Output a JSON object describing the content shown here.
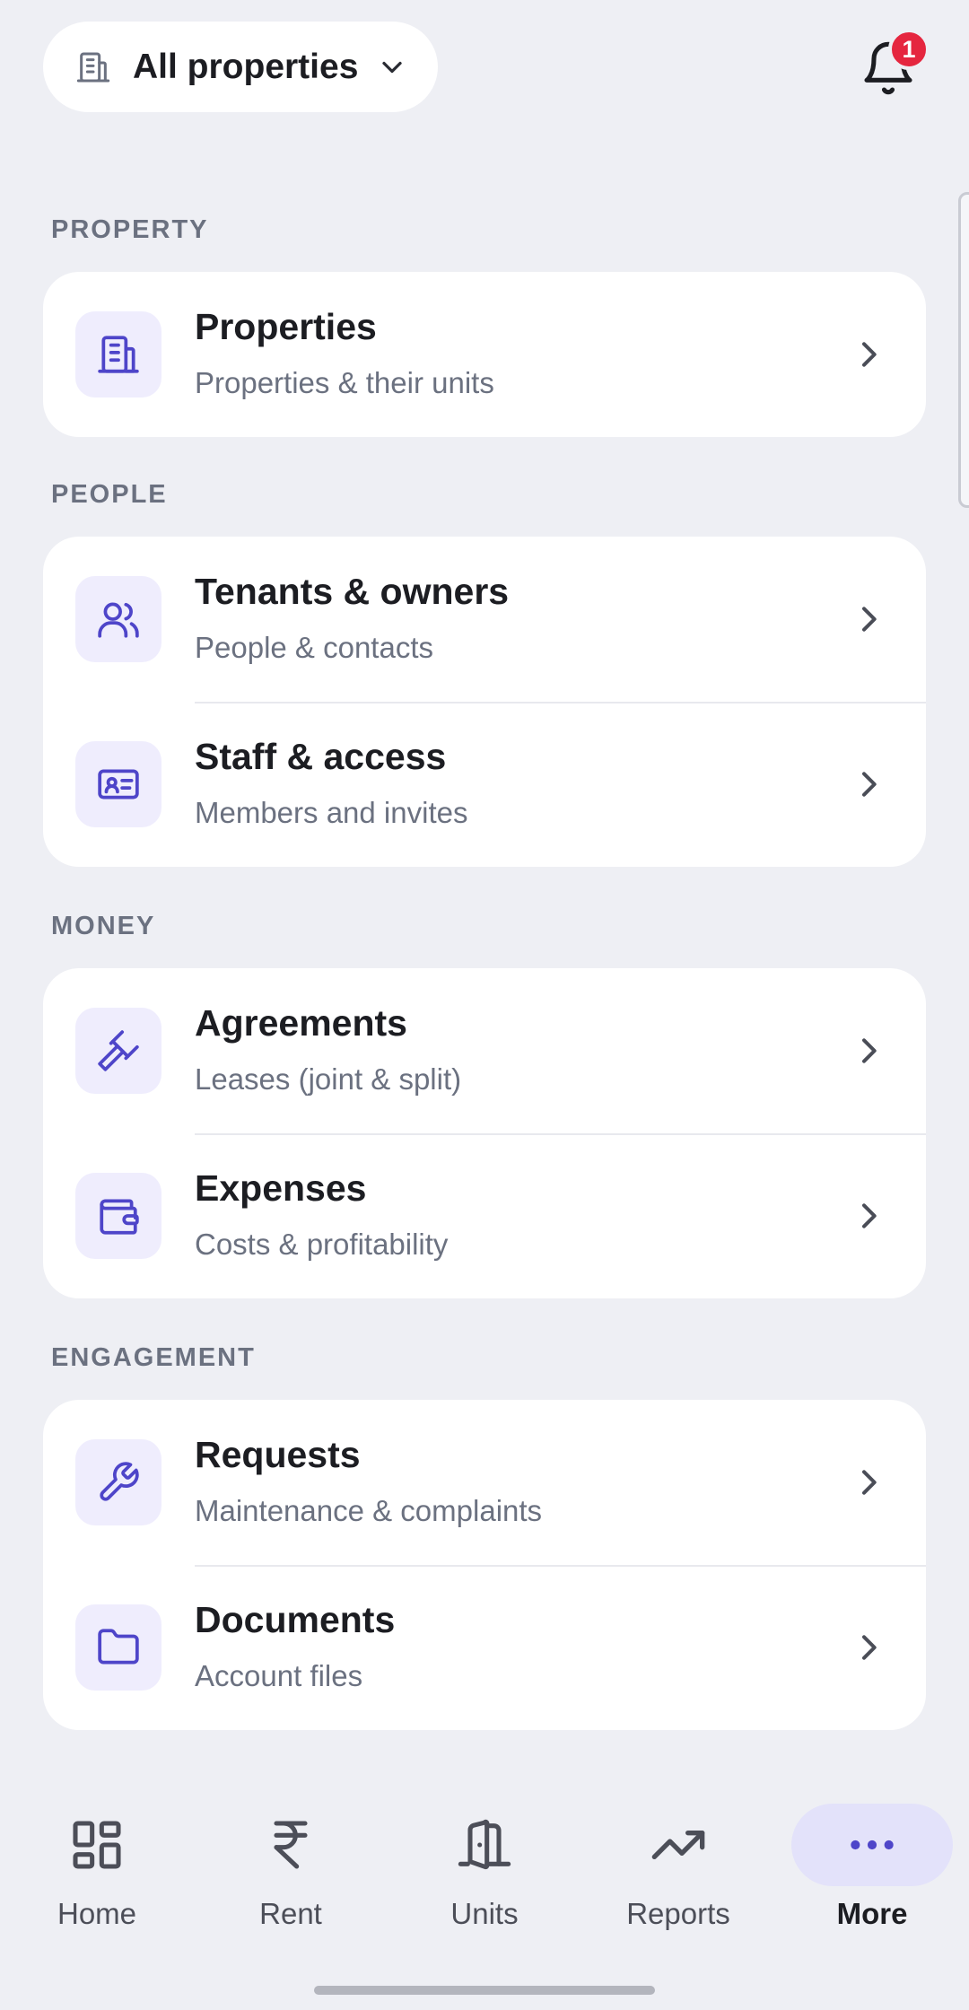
{
  "header": {
    "property_selector": {
      "label": "All properties",
      "icon": "building-icon",
      "chevron": "chevron-down-icon"
    },
    "notifications": {
      "icon": "bell-icon",
      "count": "1",
      "badge_color": "#e5263f"
    }
  },
  "sections": [
    {
      "heading": "PROPERTY",
      "items": [
        {
          "title": "Properties",
          "subtitle": "Properties & their units",
          "icon": "building-icon"
        }
      ]
    },
    {
      "heading": "PEOPLE",
      "items": [
        {
          "title": "Tenants & owners",
          "subtitle": "People & contacts",
          "icon": "users-icon"
        },
        {
          "title": "Staff & access",
          "subtitle": "Members and invites",
          "icon": "id-card-icon"
        }
      ]
    },
    {
      "heading": "MONEY",
      "items": [
        {
          "title": "Agreements",
          "subtitle": "Leases (joint & split)",
          "icon": "gavel-icon"
        },
        {
          "title": "Expenses",
          "subtitle": "Costs & profitability",
          "icon": "wallet-icon"
        }
      ]
    },
    {
      "heading": "ENGAGEMENT",
      "items": [
        {
          "title": "Requests",
          "subtitle": "Maintenance & complaints",
          "icon": "wrench-icon"
        },
        {
          "title": "Documents",
          "subtitle": "Account files",
          "icon": "folder-icon"
        }
      ]
    }
  ],
  "bottom_nav": {
    "active": "More",
    "items": [
      {
        "label": "Home",
        "icon": "dashboard-grid-icon"
      },
      {
        "label": "Rent",
        "icon": "rupee-icon"
      },
      {
        "label": "Units",
        "icon": "door-icon"
      },
      {
        "label": "Reports",
        "icon": "trending-up-icon"
      },
      {
        "label": "More",
        "icon": "more-horizontal-icon"
      }
    ]
  },
  "colors": {
    "background": "#eeeff4",
    "accent": "#4e45c9",
    "icon_tile": "#efedfd",
    "active_nav_pill": "#e3e2fa"
  }
}
